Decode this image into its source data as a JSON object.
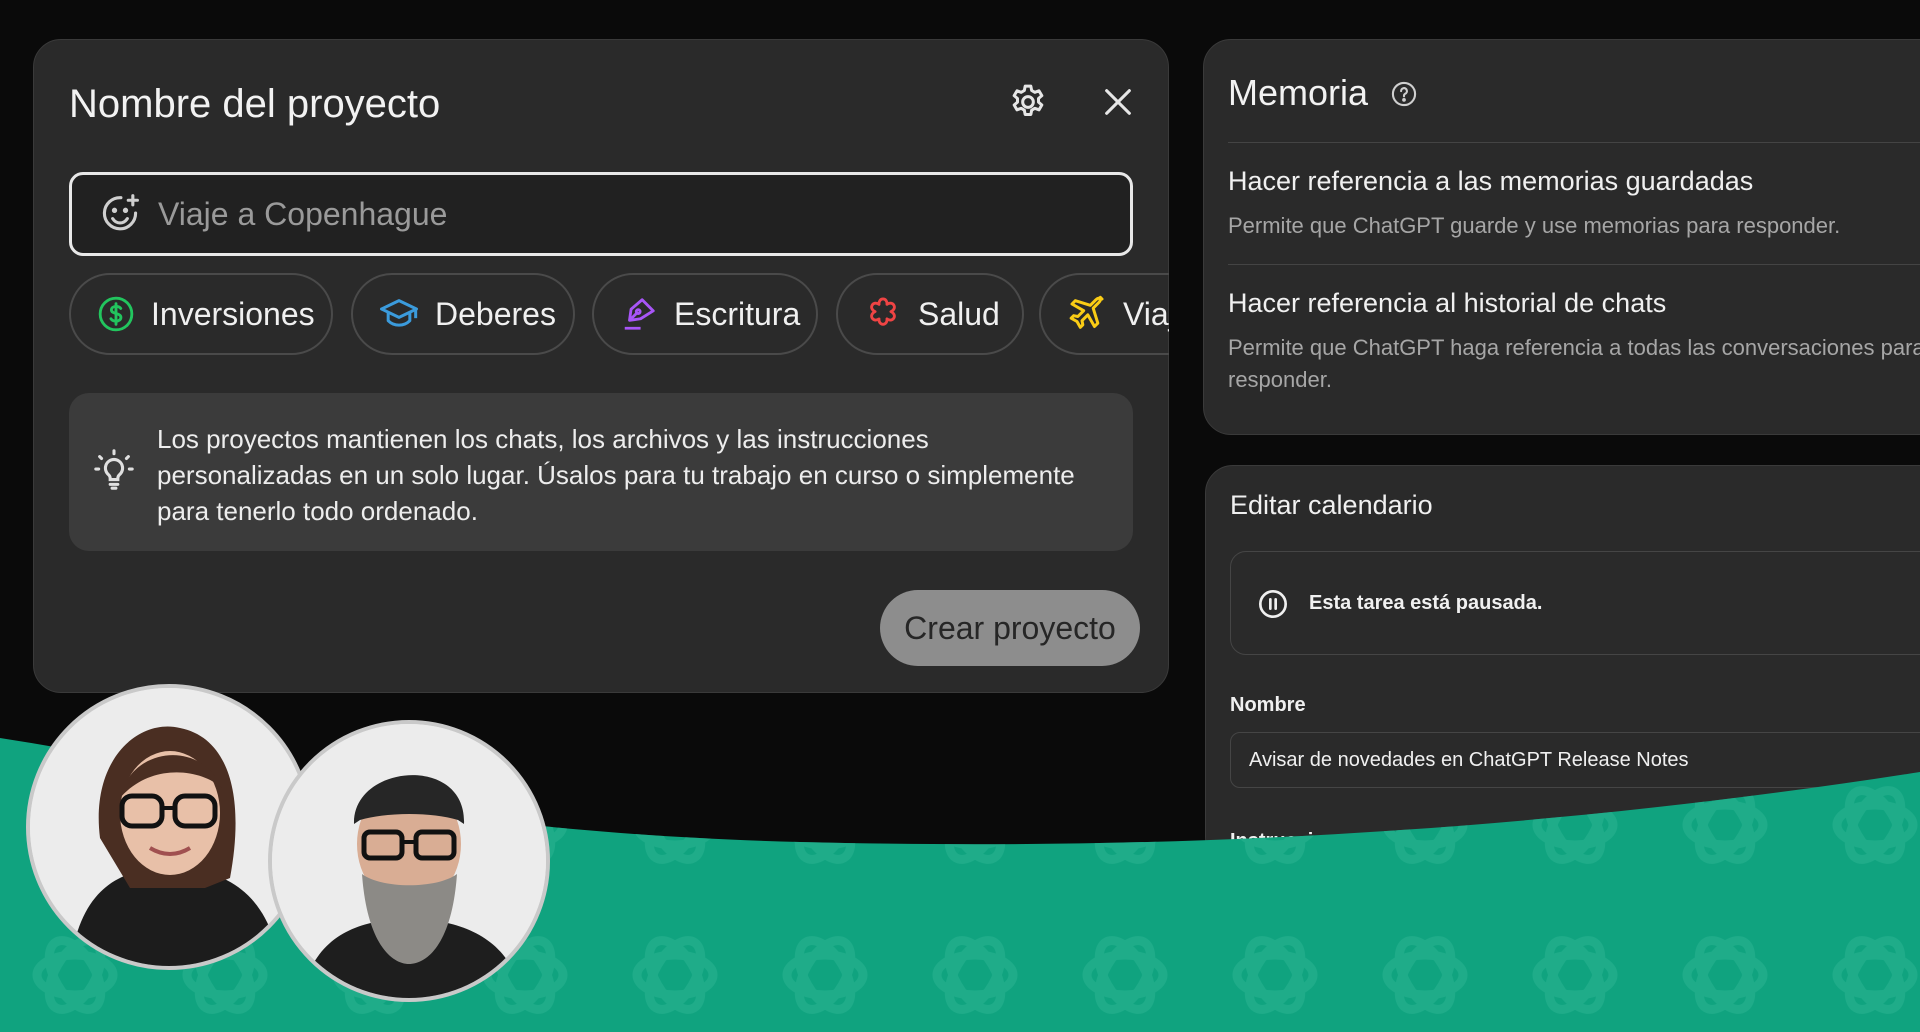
{
  "project_dialog": {
    "title": "Nombre del proyecto",
    "name_placeholder": "Viaje a Copenhague",
    "chips": [
      {
        "label": "Inversiones",
        "icon": "dollar-icon",
        "color": "#22c55e"
      },
      {
        "label": "Deberes",
        "icon": "graduation-cap-icon",
        "color": "#3b9bdc"
      },
      {
        "label": "Escritura",
        "icon": "pen-icon",
        "color": "#a855f7"
      },
      {
        "label": "Salud",
        "icon": "health-icon",
        "color": "#ef4444"
      },
      {
        "label": "Viaj",
        "icon": "plane-icon",
        "color": "#facc15"
      }
    ],
    "tip": "Los proyectos mantienen los chats, los archivos y las instrucciones personalizadas en un solo lugar. Úsalos para tu trabajo en curso o simplemente para tenerlo todo ordenado.",
    "create_button": "Crear proyecto"
  },
  "memory_panel": {
    "title": "Memoria",
    "items": [
      {
        "heading": "Hacer referencia a las memorias guardadas",
        "description": "Permite que ChatGPT guarde y use memorias para responder."
      },
      {
        "heading": "Hacer referencia al historial de chats",
        "description": "Permite que ChatGPT haga referencia a todas las conversaciones para responder."
      }
    ]
  },
  "calendar_panel": {
    "title": "Editar calendario",
    "paused_notice": "Esta tarea está pausada.",
    "name_label": "Nombre",
    "name_value": "Avisar de novedades en ChatGPT Release Notes",
    "instructions_label": "Instrucciones"
  },
  "colors": {
    "background": "#0a0a0a",
    "panel": "#2a2a2a",
    "brand_wave": "#10a37f",
    "create_button": "#8d8d8d"
  }
}
